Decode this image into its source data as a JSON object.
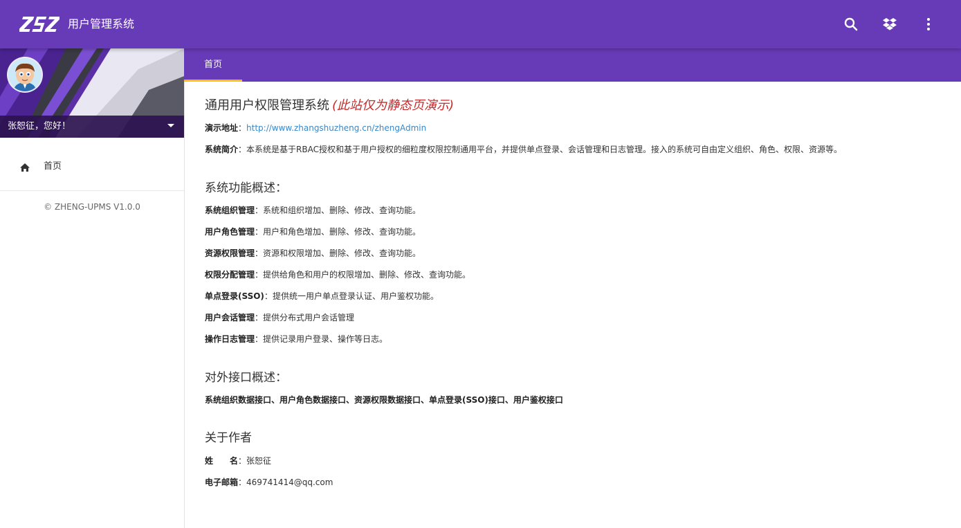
{
  "header": {
    "logo_text": "ZSZ",
    "app_title": "用户管理系统",
    "icons": [
      "search-icon",
      "dropbox-icon",
      "more-vert-icon"
    ],
    "color": "#673ab7"
  },
  "sidebar": {
    "greeting": "张恕征，您好！",
    "nav": [
      {
        "icon": "home-icon",
        "label": "首页"
      }
    ],
    "copyright": "© ZHENG-UPMS V1.0.0"
  },
  "tabs": [
    {
      "label": "首页",
      "active": true
    }
  ],
  "main": {
    "title": "通用用户权限管理系统",
    "title_note": "(此站仅为静态页演示)",
    "demo_label": "演示地址",
    "demo_url": "http://www.zhangshuzheng.cn/zhengAdmin",
    "intro_label": "系统简介",
    "intro_text": "本系统是基于RBAC授权和基于用户授权的细粒度权限控制通用平台，并提供单点登录、会话管理和日志管理。接入的系统可自由定义组织、角色、权限、资源等。",
    "features_title": "系统功能概述：",
    "features": [
      {
        "label": "系统组织管理",
        "text": "系统和组织增加、删除、修改、查询功能。"
      },
      {
        "label": "用户角色管理",
        "text": "用户和角色增加、删除、修改、查询功能。"
      },
      {
        "label": "资源权限管理",
        "text": "资源和权限增加、删除、修改、查询功能。"
      },
      {
        "label": "权限分配管理",
        "text": "提供给角色和用户的权限增加、删除、修改、查询功能。"
      },
      {
        "label": "单点登录(SSO)",
        "text": "提供统一用户单点登录认证、用户鉴权功能。"
      },
      {
        "label": "用户会话管理",
        "text": "提供分布式用户会话管理"
      },
      {
        "label": "操作日志管理",
        "text": "提供记录用户登录、操作等日志。"
      }
    ],
    "api_title": "对外接口概述：",
    "api_text": "系统组织数据接口、用户角色数据接口、资源权限数据接口、单点登录(SSO)接口、用户鉴权接口",
    "author_title": "关于作者",
    "author_name_label": "姓　　名",
    "author_name": "张恕征",
    "author_email_label": "电子邮箱",
    "author_email": "469741414@qq.com"
  }
}
